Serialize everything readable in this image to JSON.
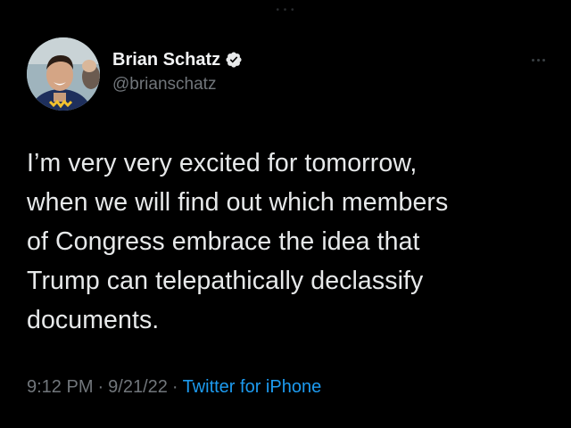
{
  "tweet": {
    "author": {
      "display_name": "Brian Schatz",
      "handle": "@brianschatz",
      "verified": true
    },
    "text": "I’m very very excited for tomorrow,\nwhen we will find out which members\nof Congress embrace the idea that\nTrump can telepathically declassify\ndocuments.",
    "time": "9:12 PM",
    "date": "9/21/22",
    "separator": "·",
    "source": "Twitter for iPhone"
  },
  "icons": {
    "verified": "verified-badge-icon",
    "more": "more-options-icon"
  },
  "colors": {
    "background": "#000000",
    "text_primary": "#e7e9ea",
    "text_secondary": "#71767b",
    "link": "#1d9bf0",
    "verified_badge": "#e7e9ea"
  }
}
